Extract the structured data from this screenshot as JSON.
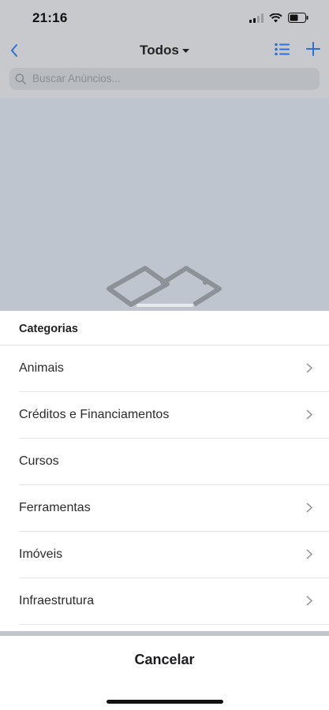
{
  "status_bar": {
    "time": "21:16"
  },
  "nav": {
    "title": "Todos"
  },
  "search": {
    "placeholder": "Buscar Anúncios..."
  },
  "sheet": {
    "header": "Categorias",
    "items": [
      {
        "label": "Animais",
        "has_chevron": true
      },
      {
        "label": "Créditos e Financiamentos",
        "has_chevron": true
      },
      {
        "label": "Cursos",
        "has_chevron": false
      },
      {
        "label": "Ferramentas",
        "has_chevron": true
      },
      {
        "label": "Imóveis",
        "has_chevron": true
      },
      {
        "label": "Infraestrutura",
        "has_chevron": true
      }
    ],
    "cancel_label": "Cancelar"
  },
  "colors": {
    "accent": "#2f6fd6",
    "overlay": "#c2c6cc"
  }
}
